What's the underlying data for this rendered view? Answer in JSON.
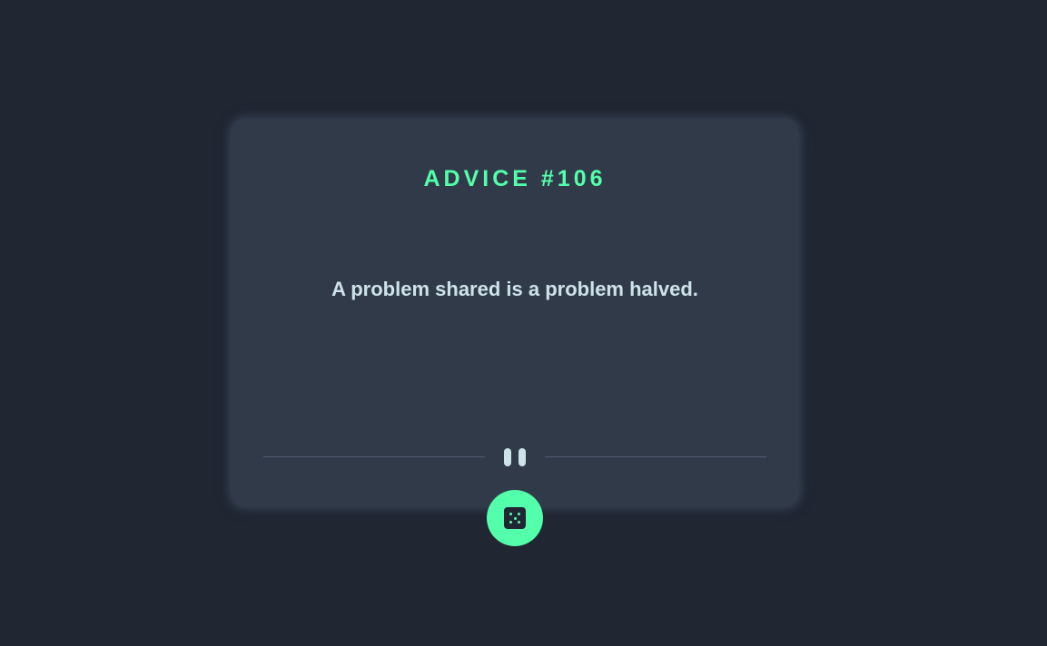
{
  "advice": {
    "title": "ADVICE #106",
    "quote": "A problem shared is a problem halved."
  },
  "divider": {
    "icon": "pause-icon"
  },
  "actions": {
    "generate_icon": "dice-icon"
  },
  "colors": {
    "background": "#202632",
    "card": "#313a49",
    "accent": "#53ffaa",
    "text": "#cee3e9",
    "divider": "#4f5d73"
  }
}
